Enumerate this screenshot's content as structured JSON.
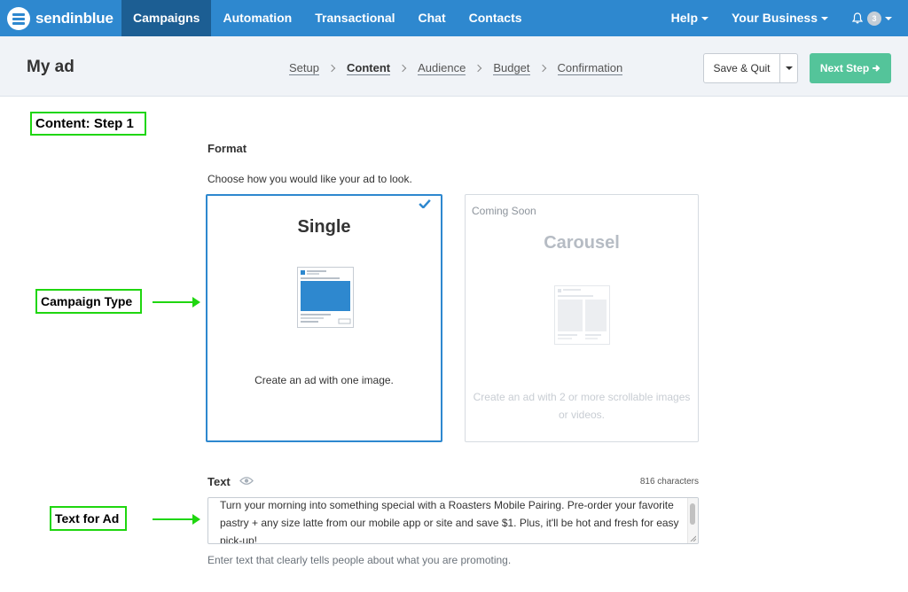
{
  "nav": {
    "brand": "sendinblue",
    "items": [
      {
        "label": "Campaigns",
        "active": true
      },
      {
        "label": "Automation"
      },
      {
        "label": "Transactional"
      },
      {
        "label": "Chat"
      },
      {
        "label": "Contacts"
      }
    ],
    "help": "Help",
    "business": "Your Business",
    "notification_count": "3"
  },
  "header": {
    "title": "My ad",
    "steps": [
      "Setup",
      "Content",
      "Audience",
      "Budget",
      "Confirmation"
    ],
    "current_step": "Content",
    "save_label": "Save & Quit",
    "next_label": "Next Step"
  },
  "annotations": {
    "step": "Content: Step 1",
    "campaign_type": "Campaign Type",
    "text_for_ad": "Text for Ad"
  },
  "format": {
    "label": "Format",
    "help": "Choose how you would like your ad to look.",
    "single": {
      "title": "Single",
      "description": "Create an ad with one image.",
      "selected": true
    },
    "carousel": {
      "badge": "Coming Soon",
      "title": "Carousel",
      "description": "Create an ad with 2 or more scrollable images or videos."
    }
  },
  "text": {
    "label": "Text",
    "char_count": "816 characters",
    "value": "Turn your morning into something special with a Roasters Mobile Pairing. Pre-order your favorite pastry + any size latte from our mobile app or site and save $1. Plus, it'll be hot and fresh for easy pick-up!",
    "help": "Enter text that clearly tells people about what you are promoting."
  },
  "colors": {
    "nav_bg": "#2e88cf",
    "nav_active": "#1c5e93",
    "next_button": "#54c49a",
    "annotation": "#1fd60f"
  }
}
